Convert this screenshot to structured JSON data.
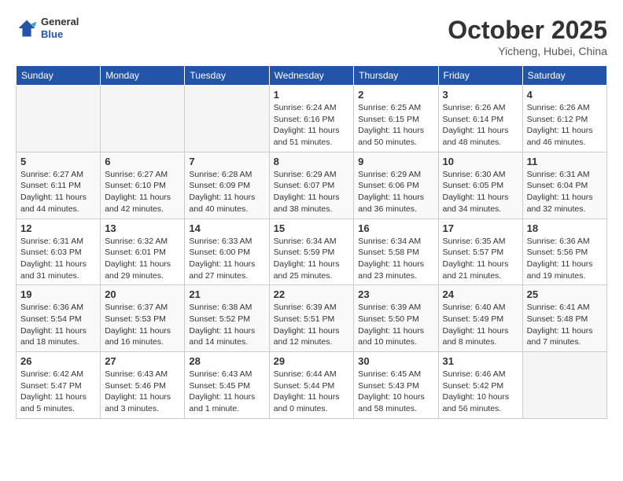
{
  "header": {
    "logo_general": "General",
    "logo_blue": "Blue",
    "month": "October 2025",
    "location": "Yicheng, Hubei, China"
  },
  "days_of_week": [
    "Sunday",
    "Monday",
    "Tuesday",
    "Wednesday",
    "Thursday",
    "Friday",
    "Saturday"
  ],
  "weeks": [
    [
      {
        "day": "",
        "empty": true
      },
      {
        "day": "",
        "empty": true
      },
      {
        "day": "",
        "empty": true
      },
      {
        "day": "1",
        "sunrise": "Sunrise: 6:24 AM",
        "sunset": "Sunset: 6:16 PM",
        "daylight": "Daylight: 11 hours and 51 minutes."
      },
      {
        "day": "2",
        "sunrise": "Sunrise: 6:25 AM",
        "sunset": "Sunset: 6:15 PM",
        "daylight": "Daylight: 11 hours and 50 minutes."
      },
      {
        "day": "3",
        "sunrise": "Sunrise: 6:26 AM",
        "sunset": "Sunset: 6:14 PM",
        "daylight": "Daylight: 11 hours and 48 minutes."
      },
      {
        "day": "4",
        "sunrise": "Sunrise: 6:26 AM",
        "sunset": "Sunset: 6:12 PM",
        "daylight": "Daylight: 11 hours and 46 minutes."
      }
    ],
    [
      {
        "day": "5",
        "sunrise": "Sunrise: 6:27 AM",
        "sunset": "Sunset: 6:11 PM",
        "daylight": "Daylight: 11 hours and 44 minutes."
      },
      {
        "day": "6",
        "sunrise": "Sunrise: 6:27 AM",
        "sunset": "Sunset: 6:10 PM",
        "daylight": "Daylight: 11 hours and 42 minutes."
      },
      {
        "day": "7",
        "sunrise": "Sunrise: 6:28 AM",
        "sunset": "Sunset: 6:09 PM",
        "daylight": "Daylight: 11 hours and 40 minutes."
      },
      {
        "day": "8",
        "sunrise": "Sunrise: 6:29 AM",
        "sunset": "Sunset: 6:07 PM",
        "daylight": "Daylight: 11 hours and 38 minutes."
      },
      {
        "day": "9",
        "sunrise": "Sunrise: 6:29 AM",
        "sunset": "Sunset: 6:06 PM",
        "daylight": "Daylight: 11 hours and 36 minutes."
      },
      {
        "day": "10",
        "sunrise": "Sunrise: 6:30 AM",
        "sunset": "Sunset: 6:05 PM",
        "daylight": "Daylight: 11 hours and 34 minutes."
      },
      {
        "day": "11",
        "sunrise": "Sunrise: 6:31 AM",
        "sunset": "Sunset: 6:04 PM",
        "daylight": "Daylight: 11 hours and 32 minutes."
      }
    ],
    [
      {
        "day": "12",
        "sunrise": "Sunrise: 6:31 AM",
        "sunset": "Sunset: 6:03 PM",
        "daylight": "Daylight: 11 hours and 31 minutes."
      },
      {
        "day": "13",
        "sunrise": "Sunrise: 6:32 AM",
        "sunset": "Sunset: 6:01 PM",
        "daylight": "Daylight: 11 hours and 29 minutes."
      },
      {
        "day": "14",
        "sunrise": "Sunrise: 6:33 AM",
        "sunset": "Sunset: 6:00 PM",
        "daylight": "Daylight: 11 hours and 27 minutes."
      },
      {
        "day": "15",
        "sunrise": "Sunrise: 6:34 AM",
        "sunset": "Sunset: 5:59 PM",
        "daylight": "Daylight: 11 hours and 25 minutes."
      },
      {
        "day": "16",
        "sunrise": "Sunrise: 6:34 AM",
        "sunset": "Sunset: 5:58 PM",
        "daylight": "Daylight: 11 hours and 23 minutes."
      },
      {
        "day": "17",
        "sunrise": "Sunrise: 6:35 AM",
        "sunset": "Sunset: 5:57 PM",
        "daylight": "Daylight: 11 hours and 21 minutes."
      },
      {
        "day": "18",
        "sunrise": "Sunrise: 6:36 AM",
        "sunset": "Sunset: 5:56 PM",
        "daylight": "Daylight: 11 hours and 19 minutes."
      }
    ],
    [
      {
        "day": "19",
        "sunrise": "Sunrise: 6:36 AM",
        "sunset": "Sunset: 5:54 PM",
        "daylight": "Daylight: 11 hours and 18 minutes."
      },
      {
        "day": "20",
        "sunrise": "Sunrise: 6:37 AM",
        "sunset": "Sunset: 5:53 PM",
        "daylight": "Daylight: 11 hours and 16 minutes."
      },
      {
        "day": "21",
        "sunrise": "Sunrise: 6:38 AM",
        "sunset": "Sunset: 5:52 PM",
        "daylight": "Daylight: 11 hours and 14 minutes."
      },
      {
        "day": "22",
        "sunrise": "Sunrise: 6:39 AM",
        "sunset": "Sunset: 5:51 PM",
        "daylight": "Daylight: 11 hours and 12 minutes."
      },
      {
        "day": "23",
        "sunrise": "Sunrise: 6:39 AM",
        "sunset": "Sunset: 5:50 PM",
        "daylight": "Daylight: 11 hours and 10 minutes."
      },
      {
        "day": "24",
        "sunrise": "Sunrise: 6:40 AM",
        "sunset": "Sunset: 5:49 PM",
        "daylight": "Daylight: 11 hours and 8 minutes."
      },
      {
        "day": "25",
        "sunrise": "Sunrise: 6:41 AM",
        "sunset": "Sunset: 5:48 PM",
        "daylight": "Daylight: 11 hours and 7 minutes."
      }
    ],
    [
      {
        "day": "26",
        "sunrise": "Sunrise: 6:42 AM",
        "sunset": "Sunset: 5:47 PM",
        "daylight": "Daylight: 11 hours and 5 minutes."
      },
      {
        "day": "27",
        "sunrise": "Sunrise: 6:43 AM",
        "sunset": "Sunset: 5:46 PM",
        "daylight": "Daylight: 11 hours and 3 minutes."
      },
      {
        "day": "28",
        "sunrise": "Sunrise: 6:43 AM",
        "sunset": "Sunset: 5:45 PM",
        "daylight": "Daylight: 11 hours and 1 minute."
      },
      {
        "day": "29",
        "sunrise": "Sunrise: 6:44 AM",
        "sunset": "Sunset: 5:44 PM",
        "daylight": "Daylight: 11 hours and 0 minutes."
      },
      {
        "day": "30",
        "sunrise": "Sunrise: 6:45 AM",
        "sunset": "Sunset: 5:43 PM",
        "daylight": "Daylight: 10 hours and 58 minutes."
      },
      {
        "day": "31",
        "sunrise": "Sunrise: 6:46 AM",
        "sunset": "Sunset: 5:42 PM",
        "daylight": "Daylight: 10 hours and 56 minutes."
      },
      {
        "day": "",
        "empty": true
      }
    ]
  ]
}
